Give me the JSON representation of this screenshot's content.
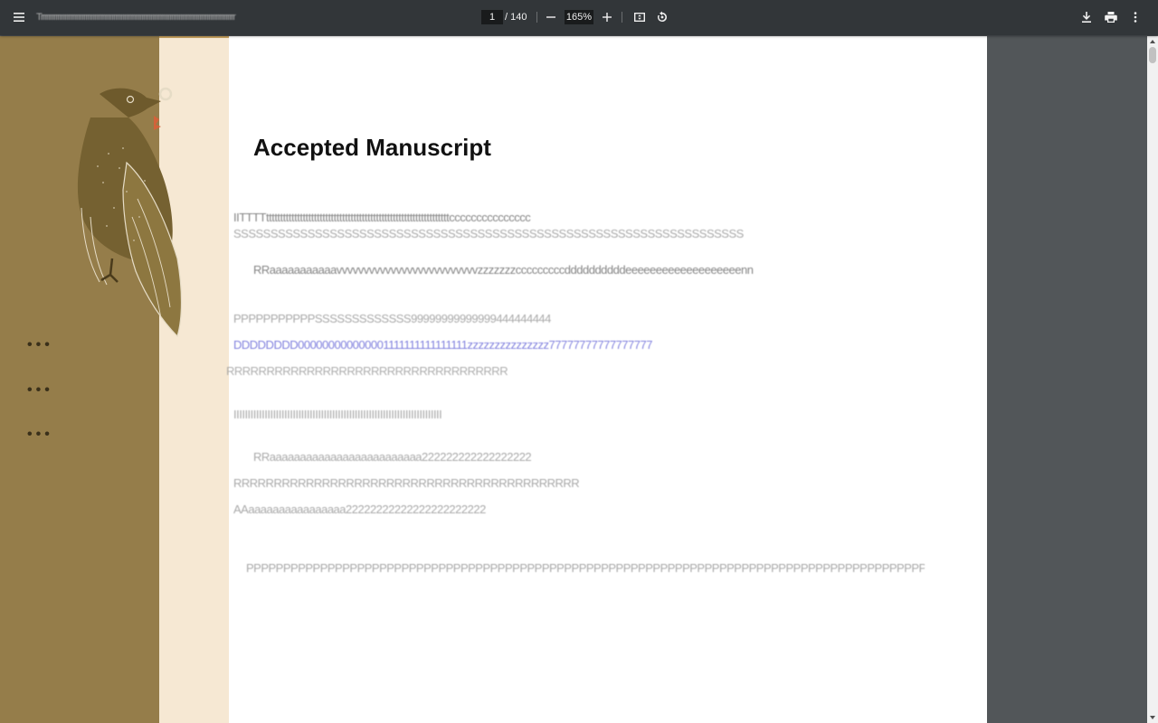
{
  "toolbar": {
    "title_blurred": "Trrrrrrrrrrrrrrrrrrrrrrrrrrrrrrrrrrrrrrrrrrrrrrrrrrrrrrrrrrrrrrrrrrrrrrrrrrrrrrrrrrrrrrrrrrrrrrrrrrrrrrrr",
    "page_current": "1",
    "page_total": "/ 140",
    "zoom": "165%"
  },
  "document": {
    "heading": "Accepted Manuscript",
    "blurred_lines": [
      "IITTTTtttttttttttttttttttttttttttttttttttttttttttttttttttttttttttttttttccccccccccccccc",
      "SSSSSSSSSSSSSSSSSSSSSSSSSSSSSSSSSSSSSSSSSSSSSSSSSSSSSSSSSSSSSSSSSSSSS",
      "RRaaaaaaaaaaavvvvvvvvvvvvvvvvvvvvvvvvvvzzzzzzzcccccccccddddddddddeeeeeeeeeeeeeeeeeeenn",
      "PPPPPPPPPPPSSSSSSSSSSSSS99999999999999444444444",
      "DDDDDDDD000000000000001111111111111111zzzzzzzzzzzzzzz77777777777777777",
      "RRRRRRRRRRRRRRRRRRRRRRRRRRRRRRRRRRR",
      "IIIIIIIIIIIIIIIIIIIIIIIIIIIIIIIIIIIIIIIIIIIIIIIIIIIIIIIIIIIIIIIIIIIIIIIIII",
      "RRaaaaaaaaaaaaaaaaaaaaaaaaa222222222222222222",
      "RRRRRRRRRRRRRRRRRRRRRRRRRRRRRRRRRRRRRRRRRRR",
      "AAaaaaaaaaaaaaaaaa22222222222222222222222",
      "PPPPPPPPPPPPPPPPPPPPPPPPPPPPPPPPPPPPPPPPPPPPPPPPPPPPPPPPPPPPPPPPPPPPPPPPPPPPPPPPPPPPPPPPPPPPPPPPPPPPPPPPPPPPPPP"
    ]
  },
  "icons": {
    "menu": "menu-icon",
    "zoom_out": "minus-icon",
    "zoom_in": "plus-icon",
    "fit": "fit-page-icon",
    "rotate": "rotate-icon",
    "download": "download-icon",
    "print": "print-icon",
    "more": "more-vert-icon"
  },
  "colors": {
    "toolbar": "#323639",
    "viewer_bg": "#525659",
    "cover_band": "#957d4a",
    "cream_band": "#f6e8d3",
    "link_text": "#6a6ad8"
  }
}
